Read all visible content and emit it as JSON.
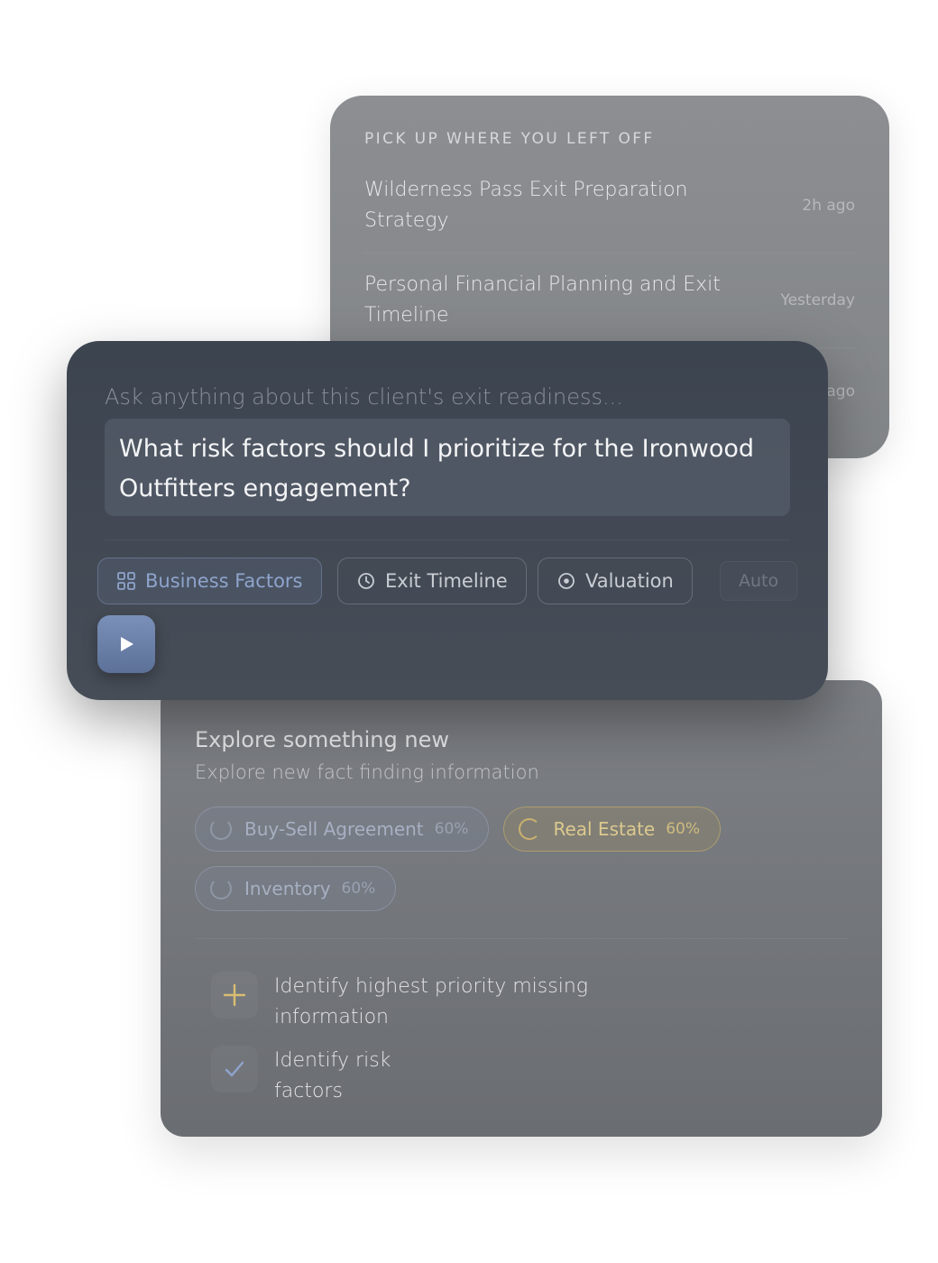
{
  "recent": {
    "heading": "PICK UP WHERE YOU LEFT OFF",
    "items": [
      {
        "title": "Wilderness Pass Exit Preparation Strategy",
        "time": "2h ago"
      },
      {
        "title": "Personal Financial Planning and Exit Timeline",
        "time": "Yesterday"
      },
      {
        "title": "",
        "time": "ago"
      }
    ]
  },
  "input": {
    "placeholder": "Ask anything about this client's exit readiness...",
    "query": "What risk factors should I prioritize for the Ironwood Outfitters engagement?",
    "pills": [
      {
        "label": "Business Factors",
        "icon": "grid-icon"
      },
      {
        "label": "Exit Timeline",
        "icon": "clock-icon"
      },
      {
        "label": "Valuation",
        "icon": "target-icon"
      }
    ],
    "auto_label": "Auto",
    "send_icon": "play-icon"
  },
  "explore": {
    "title": "Explore something new",
    "subtitle": "Explore new fact finding information",
    "chips": [
      {
        "label": "Buy-Sell Agreement",
        "percent": "60%"
      },
      {
        "label": "Real Estate",
        "percent": "60%"
      },
      {
        "label": "Inventory",
        "percent": "60%"
      }
    ],
    "actions": [
      {
        "text": "Identify highest priority missing information",
        "icon": "plus-icon"
      },
      {
        "text": "Identify risk factors",
        "icon": "check-icon"
      }
    ]
  },
  "colors": {
    "accent_blue": "#8ea4cc",
    "accent_gold": "#dcc98f",
    "card_dark": "#3c4450"
  }
}
